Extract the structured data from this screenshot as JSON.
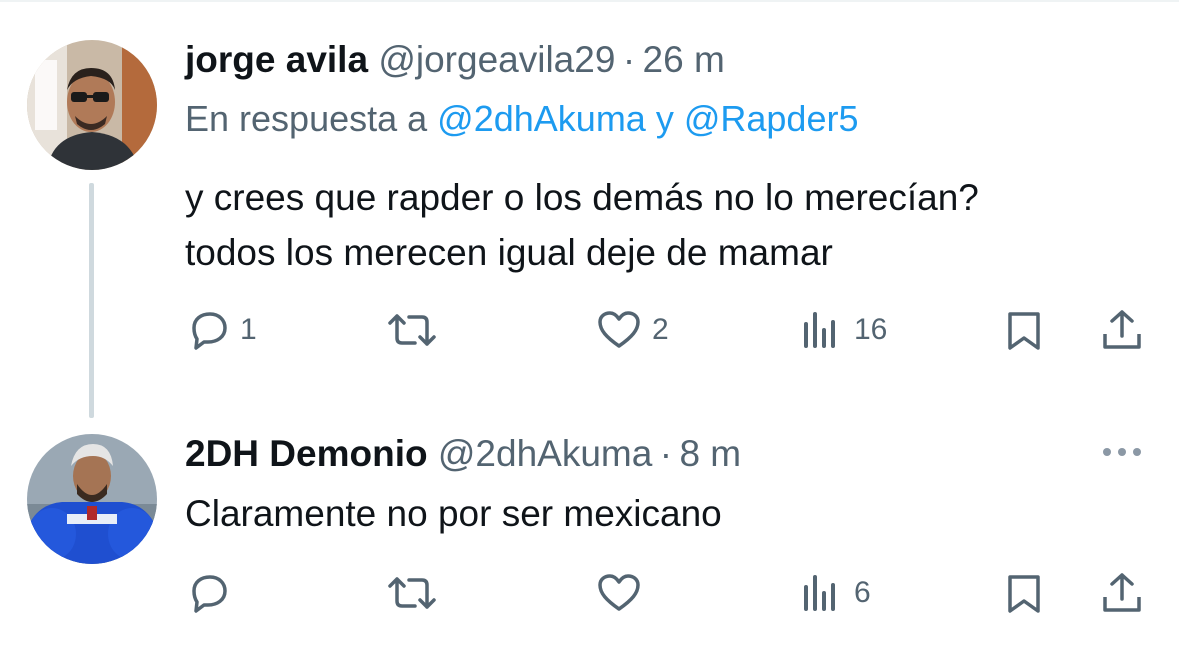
{
  "tweets": [
    {
      "display_name": "jorge avila",
      "handle": "@jorgeavila29",
      "separator": "·",
      "time": "26 m",
      "reply_prefix": "En respuesta a ",
      "reply_mention_1": "@2dhAkuma",
      "reply_and": " y ",
      "reply_mention_2": "@Rapder5",
      "text_line_1": "y crees que rapder o los demás no lo merecían?",
      "text_line_2": "todos los merecen igual deje de mamar",
      "actions": {
        "replies": "1",
        "retweets": "",
        "likes": "2",
        "views": "16"
      },
      "avatar_icon": "user-photo-sunglasses"
    },
    {
      "display_name": "2DH Demonio",
      "handle": "@2dhAkuma",
      "separator": "·",
      "time": "8 m",
      "text_line_1": "Claramente no por ser mexicano",
      "actions": {
        "replies": "",
        "retweets": "",
        "likes": "",
        "views": "6"
      },
      "avatar_icon": "user-photo-muscular-blue-shirt"
    }
  ],
  "icons": {
    "reply": "reply-icon",
    "retweet": "retweet-icon",
    "like": "heart-icon",
    "views": "views-icon",
    "bookmark": "bookmark-icon",
    "share": "share-icon",
    "more": "more-icon"
  },
  "colors": {
    "text": "#0f1419",
    "secondary": "#536471",
    "accent": "#1d9bf0",
    "thread_line": "#cfd9de"
  }
}
